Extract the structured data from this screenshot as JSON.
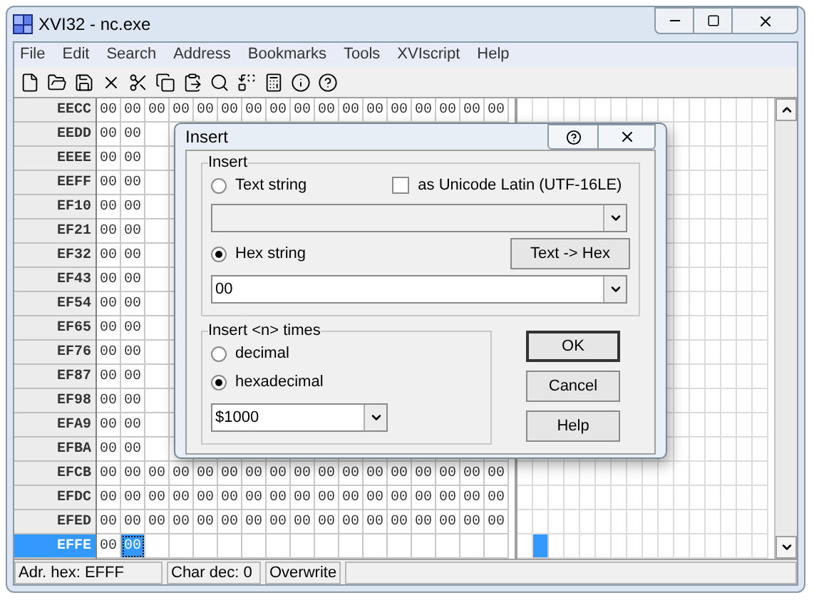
{
  "window": {
    "title": "XVI32 - nc.exe"
  },
  "menu": [
    "File",
    "Edit",
    "Search",
    "Address",
    "Bookmarks",
    "Tools",
    "XVIscript",
    "Help"
  ],
  "hex_grid": {
    "rows": [
      {
        "address": "EECC",
        "selected": false,
        "cells": [
          {
            "text": "00",
            "selected": false
          },
          {
            "text": "00",
            "selected": false
          },
          {
            "text": "00",
            "selected": false
          },
          {
            "text": "00",
            "selected": false
          },
          {
            "text": "00",
            "selected": false
          },
          {
            "text": "00",
            "selected": false
          },
          {
            "text": "00",
            "selected": false
          },
          {
            "text": "00",
            "selected": false
          },
          {
            "text": "00",
            "selected": false
          },
          {
            "text": "00",
            "selected": false
          },
          {
            "text": "00",
            "selected": false
          },
          {
            "text": "00",
            "selected": false
          },
          {
            "text": "00",
            "selected": false
          },
          {
            "text": "00",
            "selected": false
          },
          {
            "text": "00",
            "selected": false
          },
          {
            "text": "00",
            "selected": false
          },
          {
            "text": "00",
            "selected": false
          }
        ]
      },
      {
        "address": "EEDD",
        "selected": false,
        "cells": [
          {
            "text": "00",
            "selected": false
          },
          {
            "text": "00",
            "selected": false
          }
        ]
      },
      {
        "address": "EEEE",
        "selected": false,
        "cells": [
          {
            "text": "00",
            "selected": false
          },
          {
            "text": "00",
            "selected": false
          }
        ]
      },
      {
        "address": "EEFF",
        "selected": false,
        "cells": [
          {
            "text": "00",
            "selected": false
          },
          {
            "text": "00",
            "selected": false
          }
        ]
      },
      {
        "address": "EF10",
        "selected": false,
        "cells": [
          {
            "text": "00",
            "selected": false
          },
          {
            "text": "00",
            "selected": false
          }
        ]
      },
      {
        "address": "EF21",
        "selected": false,
        "cells": [
          {
            "text": "00",
            "selected": false
          },
          {
            "text": "00",
            "selected": false
          }
        ]
      },
      {
        "address": "EF32",
        "selected": false,
        "cells": [
          {
            "text": "00",
            "selected": false
          },
          {
            "text": "00",
            "selected": false
          }
        ]
      },
      {
        "address": "EF43",
        "selected": false,
        "cells": [
          {
            "text": "00",
            "selected": false
          },
          {
            "text": "00",
            "selected": false
          }
        ]
      },
      {
        "address": "EF54",
        "selected": false,
        "cells": [
          {
            "text": "00",
            "selected": false
          },
          {
            "text": "00",
            "selected": false
          }
        ]
      },
      {
        "address": "EF65",
        "selected": false,
        "cells": [
          {
            "text": "00",
            "selected": false
          },
          {
            "text": "00",
            "selected": false
          }
        ]
      },
      {
        "address": "EF76",
        "selected": false,
        "cells": [
          {
            "text": "00",
            "selected": false
          },
          {
            "text": "00",
            "selected": false
          }
        ]
      },
      {
        "address": "EF87",
        "selected": false,
        "cells": [
          {
            "text": "00",
            "selected": false
          },
          {
            "text": "00",
            "selected": false
          }
        ]
      },
      {
        "address": "EF98",
        "selected": false,
        "cells": [
          {
            "text": "00",
            "selected": false
          },
          {
            "text": "00",
            "selected": false
          }
        ]
      },
      {
        "address": "EFA9",
        "selected": false,
        "cells": [
          {
            "text": "00",
            "selected": false
          },
          {
            "text": "00",
            "selected": false
          }
        ]
      },
      {
        "address": "EFBA",
        "selected": false,
        "cells": [
          {
            "text": "00",
            "selected": false
          },
          {
            "text": "00",
            "selected": false
          }
        ]
      },
      {
        "address": "EFCB",
        "selected": false,
        "cells": [
          {
            "text": "00",
            "selected": false
          },
          {
            "text": "00",
            "selected": false
          },
          {
            "text": "00",
            "selected": false
          },
          {
            "text": "00",
            "selected": false
          },
          {
            "text": "00",
            "selected": false
          },
          {
            "text": "00",
            "selected": false
          },
          {
            "text": "00",
            "selected": false
          },
          {
            "text": "00",
            "selected": false
          },
          {
            "text": "00",
            "selected": false
          },
          {
            "text": "00",
            "selected": false
          },
          {
            "text": "00",
            "selected": false
          },
          {
            "text": "00",
            "selected": false
          },
          {
            "text": "00",
            "selected": false
          },
          {
            "text": "00",
            "selected": false
          },
          {
            "text": "00",
            "selected": false
          },
          {
            "text": "00",
            "selected": false
          },
          {
            "text": "00",
            "selected": false
          }
        ]
      },
      {
        "address": "EFDC",
        "selected": false,
        "cells": [
          {
            "text": "00",
            "selected": false
          },
          {
            "text": "00",
            "selected": false
          },
          {
            "text": "00",
            "selected": false
          },
          {
            "text": "00",
            "selected": false
          },
          {
            "text": "00",
            "selected": false
          },
          {
            "text": "00",
            "selected": false
          },
          {
            "text": "00",
            "selected": false
          },
          {
            "text": "00",
            "selected": false
          },
          {
            "text": "00",
            "selected": false
          },
          {
            "text": "00",
            "selected": false
          },
          {
            "text": "00",
            "selected": false
          },
          {
            "text": "00",
            "selected": false
          },
          {
            "text": "00",
            "selected": false
          },
          {
            "text": "00",
            "selected": false
          },
          {
            "text": "00",
            "selected": false
          },
          {
            "text": "00",
            "selected": false
          },
          {
            "text": "00",
            "selected": false
          }
        ]
      },
      {
        "address": "EFED",
        "selected": false,
        "cells": [
          {
            "text": "00",
            "selected": false
          },
          {
            "text": "00",
            "selected": false
          },
          {
            "text": "00",
            "selected": false
          },
          {
            "text": "00",
            "selected": false
          },
          {
            "text": "00",
            "selected": false
          },
          {
            "text": "00",
            "selected": false
          },
          {
            "text": "00",
            "selected": false
          },
          {
            "text": "00",
            "selected": false
          },
          {
            "text": "00",
            "selected": false
          },
          {
            "text": "00",
            "selected": false
          },
          {
            "text": "00",
            "selected": false
          },
          {
            "text": "00",
            "selected": false
          },
          {
            "text": "00",
            "selected": false
          },
          {
            "text": "00",
            "selected": false
          },
          {
            "text": "00",
            "selected": false
          },
          {
            "text": "00",
            "selected": false
          },
          {
            "text": "00",
            "selected": false
          }
        ]
      },
      {
        "address": "EFFE",
        "selected": true,
        "cells": [
          {
            "text": "00",
            "selected": false
          },
          {
            "text": "00",
            "selected": true
          }
        ]
      }
    ]
  },
  "dialog": {
    "title": "Insert",
    "insert_group": {
      "label": "Insert",
      "text_radio": {
        "label": "Text string",
        "selected": false
      },
      "unicode_checkbox": {
        "label": "as Unicode Latin (UTF-16LE)",
        "checked": false
      },
      "text_combo": {
        "disabled": true
      },
      "hex_radio": {
        "label": "Hex string",
        "selected": true
      },
      "text_to_hex_button": "Text -> Hex",
      "hex_combo": {
        "value": "00"
      }
    },
    "count_group": {
      "label": "Insert <n> times",
      "options": [
        {
          "label": "decimal",
          "selected": false
        },
        {
          "label": "hexadecimal",
          "selected": true
        }
      ],
      "count_combo": {
        "value": "$1000"
      }
    },
    "buttons": [
      {
        "label": "OK",
        "default": true
      },
      {
        "label": "Cancel",
        "default": false
      },
      {
        "label": "Help",
        "default": false
      }
    ]
  },
  "status_bar": [
    "Adr. hex: EFFF",
    "Char dec: 0",
    "Overwrite"
  ]
}
